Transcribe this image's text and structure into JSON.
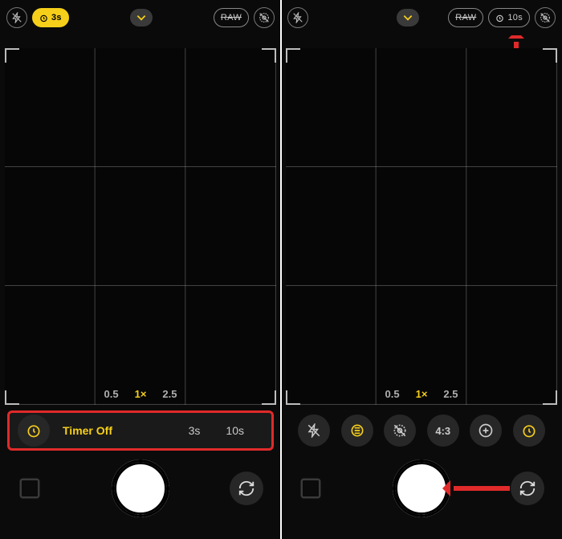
{
  "colors": {
    "accent": "#f6cf1a",
    "annotation": "#e02a2a"
  },
  "left": {
    "topbar": {
      "flash": "off",
      "timer_badge": "3s",
      "raw_label": "RAW",
      "dropdown": "chevron-down"
    },
    "zoom": {
      "opts": [
        "0.5",
        "1×",
        "2.5"
      ],
      "active": 1
    },
    "timer_panel": {
      "icon": "timer-icon",
      "label": "Timer Off",
      "opt_a": "3s",
      "opt_b": "10s"
    },
    "switch_cam": "switch-camera-icon"
  },
  "right": {
    "topbar": {
      "flash": "off",
      "dropdown": "chevron-down",
      "raw_label": "RAW",
      "timer_pill": "10s"
    },
    "zoom": {
      "opts": [
        "0.5",
        "1×",
        "2.5"
      ],
      "active": 1
    },
    "controls": {
      "flash": "flash-icon",
      "night": "night-mode-icon",
      "live": "live-photo-off-icon",
      "aspect": "4:3",
      "exposure": "exposure-icon",
      "timer": "timer-icon"
    },
    "switch_cam": "switch-camera-icon"
  }
}
